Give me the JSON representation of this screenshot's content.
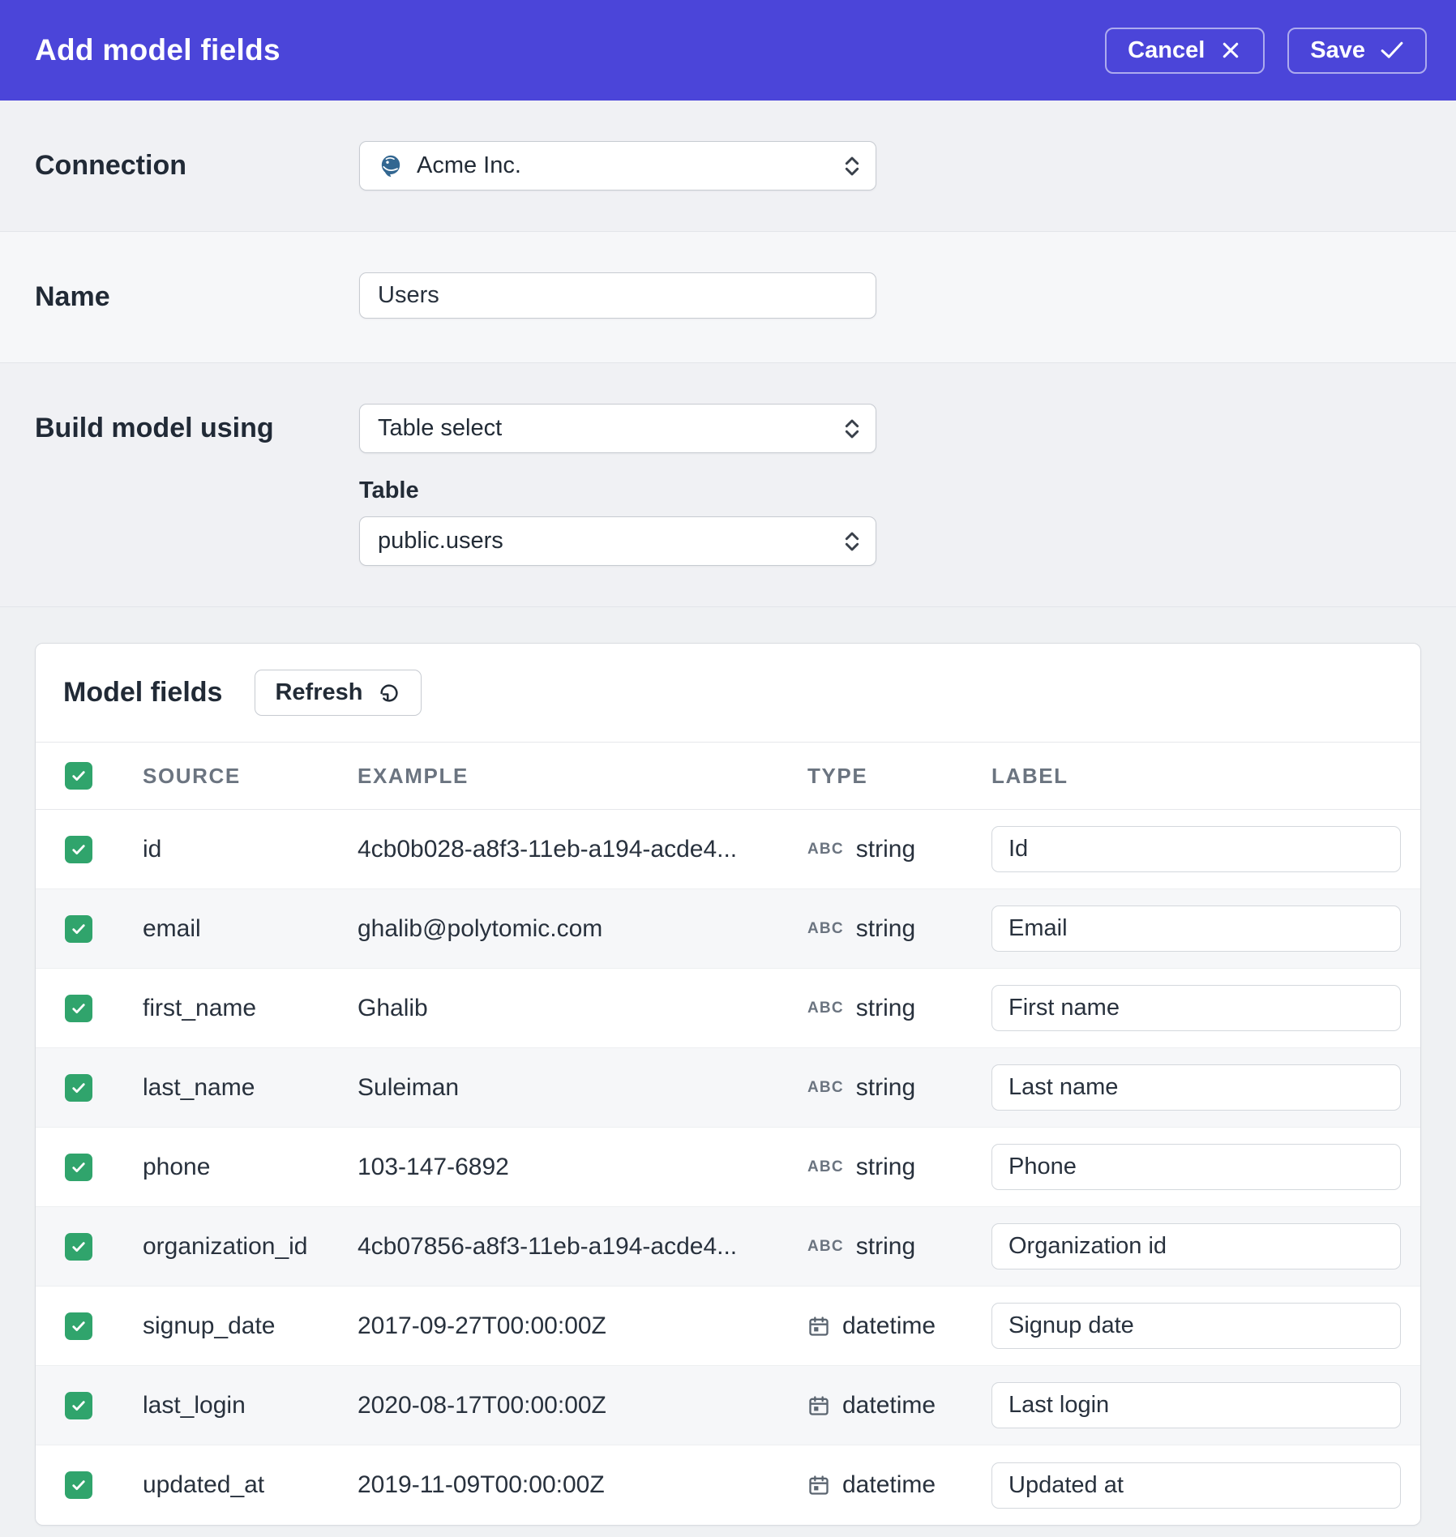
{
  "header": {
    "title": "Add model fields",
    "cancel_label": "Cancel",
    "save_label": "Save"
  },
  "form": {
    "connection": {
      "label": "Connection",
      "value": "Acme Inc.",
      "icon": "postgres-icon"
    },
    "name": {
      "label": "Name",
      "value": "Users"
    },
    "build": {
      "label": "Build model using",
      "value": "Table select",
      "table_label": "Table",
      "table_value": "public.users"
    }
  },
  "model_fields": {
    "title": "Model fields",
    "refresh_label": "Refresh",
    "columns": [
      "SOURCE",
      "EXAMPLE",
      "TYPE",
      "LABEL"
    ],
    "select_all_checked": true,
    "rows": [
      {
        "checked": true,
        "source": "id",
        "example": "4cb0b028-a8f3-11eb-a194-acde4...",
        "type": "string",
        "label": "Id"
      },
      {
        "checked": true,
        "source": "email",
        "example": "ghalib@polytomic.com",
        "type": "string",
        "label": "Email"
      },
      {
        "checked": true,
        "source": "first_name",
        "example": "Ghalib",
        "type": "string",
        "label": "First name"
      },
      {
        "checked": true,
        "source": "last_name",
        "example": "Suleiman",
        "type": "string",
        "label": "Last name"
      },
      {
        "checked": true,
        "source": "phone",
        "example": "103-147-6892",
        "type": "string",
        "label": "Phone"
      },
      {
        "checked": true,
        "source": "organization_id",
        "example": "4cb07856-a8f3-11eb-a194-acde4...",
        "type": "string",
        "label": "Organization id"
      },
      {
        "checked": true,
        "source": "signup_date",
        "example": "2017-09-27T00:00:00Z",
        "type": "datetime",
        "label": "Signup date"
      },
      {
        "checked": true,
        "source": "last_login",
        "example": "2020-08-17T00:00:00Z",
        "type": "datetime",
        "label": "Last login"
      },
      {
        "checked": true,
        "source": "updated_at",
        "example": "2019-11-09T00:00:00Z",
        "type": "datetime",
        "label": "Updated at"
      }
    ]
  },
  "colors": {
    "accent": "#4b45d9",
    "checkbox_green": "#30a46c"
  }
}
